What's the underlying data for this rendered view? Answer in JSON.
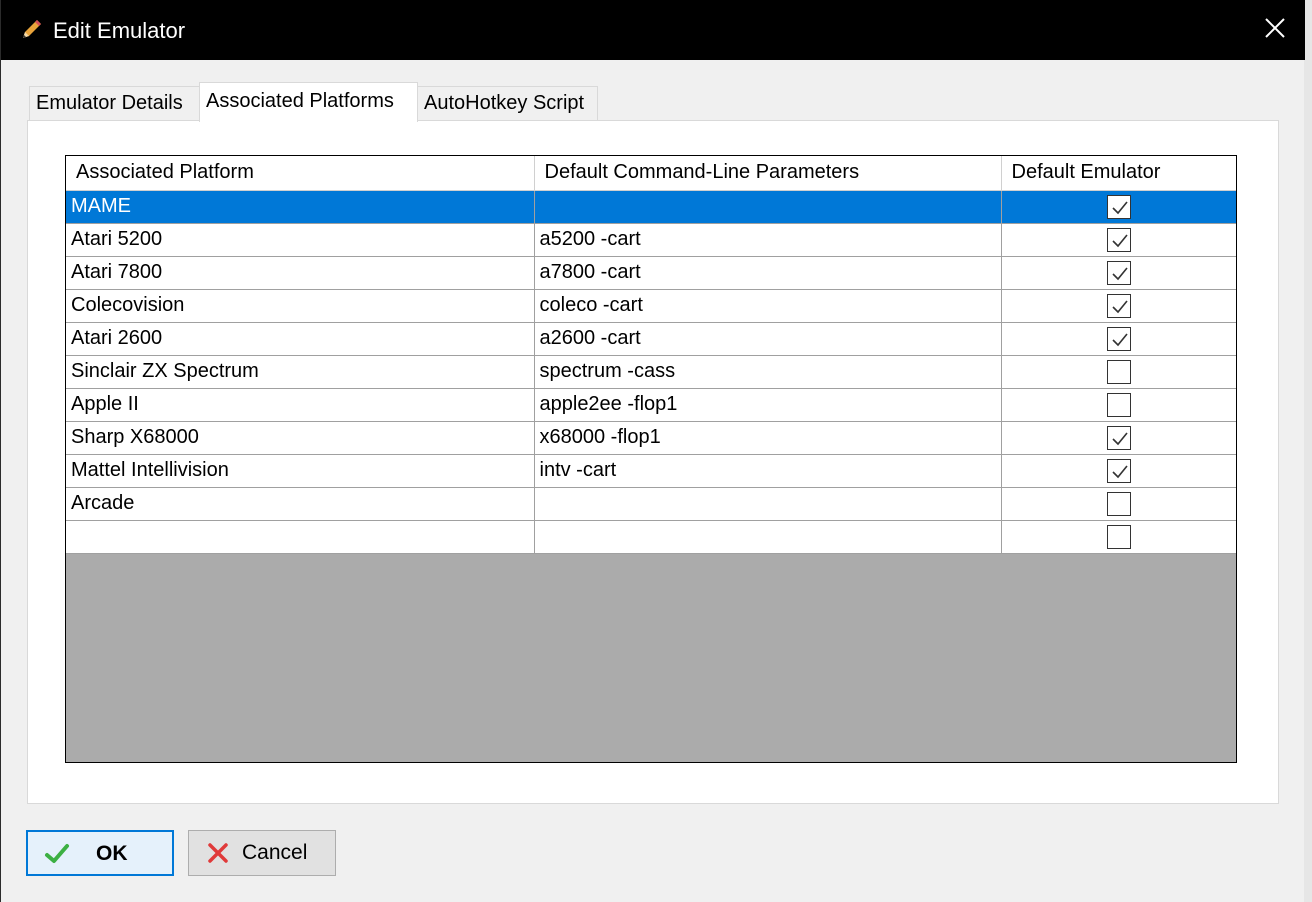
{
  "window": {
    "title": "Edit Emulator"
  },
  "tabs": [
    {
      "label": "Emulator Details",
      "active": false
    },
    {
      "label": "Associated Platforms",
      "active": true
    },
    {
      "label": "AutoHotkey Script",
      "active": false
    }
  ],
  "grid": {
    "columns": [
      "Associated Platform",
      "Default Command-Line Parameters",
      "Default Emulator"
    ],
    "rows": [
      {
        "platform": "MAME",
        "params": "",
        "default": true,
        "selected": true
      },
      {
        "platform": "Atari 5200",
        "params": "a5200 -cart",
        "default": true,
        "selected": false
      },
      {
        "platform": "Atari 7800",
        "params": "a7800 -cart",
        "default": true,
        "selected": false
      },
      {
        "platform": "Colecovision",
        "params": "coleco -cart",
        "default": true,
        "selected": false
      },
      {
        "platform": "Atari 2600",
        "params": "a2600 -cart",
        "default": true,
        "selected": false
      },
      {
        "platform": "Sinclair ZX Spectrum",
        "params": "spectrum -cass",
        "default": false,
        "selected": false
      },
      {
        "platform": "Apple II",
        "params": "apple2ee -flop1",
        "default": false,
        "selected": false
      },
      {
        "platform": "Sharp X68000",
        "params": "x68000 -flop1",
        "default": true,
        "selected": false
      },
      {
        "platform": "Mattel Intellivision",
        "params": "intv -cart",
        "default": true,
        "selected": false
      },
      {
        "platform": "Arcade",
        "params": "",
        "default": false,
        "selected": false
      },
      {
        "platform": "",
        "params": "",
        "default": false,
        "selected": false
      }
    ]
  },
  "buttons": {
    "ok_label": "OK",
    "cancel_label": "Cancel"
  },
  "colors": {
    "selection": "#0078d7",
    "titlebar": "#000000",
    "ok_check": "#3cb043",
    "cancel_x": "#e03a3a"
  },
  "icons": {
    "title": "pencil-icon",
    "close": "close-icon",
    "ok": "checkmark-icon",
    "cancel": "x-icon",
    "checkbox": "checkbox-check-icon"
  }
}
